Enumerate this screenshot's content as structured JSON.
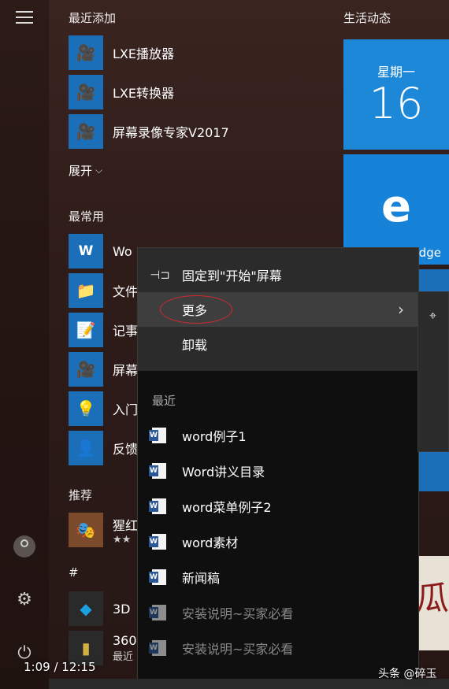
{
  "left_panel": {
    "recent_added_title": "最近添加",
    "recent_apps": [
      {
        "label": "LXE播放器",
        "icon": "camera-icon"
      },
      {
        "label": "LXE转换器",
        "icon": "camera-icon"
      },
      {
        "label": "屏幕录像专家V2017",
        "icon": "camera-icon"
      }
    ],
    "expand_label": "展开",
    "most_used_title": "最常用",
    "most_used_apps": [
      {
        "label": "Wo",
        "icon": "word-icon"
      },
      {
        "label": "文件",
        "icon": "folder-icon"
      },
      {
        "label": "记事",
        "icon": "notepad-icon"
      },
      {
        "label": "屏幕",
        "icon": "camera-icon"
      },
      {
        "label": "入门",
        "icon": "lightbulb-icon"
      },
      {
        "label": "反馈",
        "icon": "feedback-icon"
      }
    ],
    "recommended_title": "推荐",
    "recommended_app": {
      "label": "猩红",
      "sub": "★★"
    },
    "hash_title": "#",
    "hash_apps": [
      {
        "label": "3D"
      },
      {
        "label": "360",
        "sub": "最近"
      }
    ]
  },
  "tiles": {
    "title": "生活动态",
    "calendar_day": "星期一",
    "calendar_num": "16",
    "edge_label": "dge",
    "bottom_chars": "瓜"
  },
  "context_menu": {
    "pin_label": "固定到\"开始\"屏幕",
    "more_label": "更多",
    "uninstall_label": "卸载",
    "recent_title": "最近",
    "recent_items": [
      {
        "label": "word例子1",
        "dim": false
      },
      {
        "label": "Word讲义目录",
        "dim": false
      },
      {
        "label": "word菜单例子2",
        "dim": false
      },
      {
        "label": "word素材",
        "dim": false
      },
      {
        "label": "新闻稿",
        "dim": false
      },
      {
        "label": "安装说明~买家必看",
        "dim": true
      },
      {
        "label": "安装说明~买家必看",
        "dim": true
      }
    ]
  },
  "video": {
    "time": "1:09 / 12:15"
  },
  "watermark": "头条 @碎玉",
  "colors": {
    "tile_blue": "#1e88d8",
    "menu_bg": "#0f0f0f",
    "annotation_red": "#d42a2a"
  }
}
